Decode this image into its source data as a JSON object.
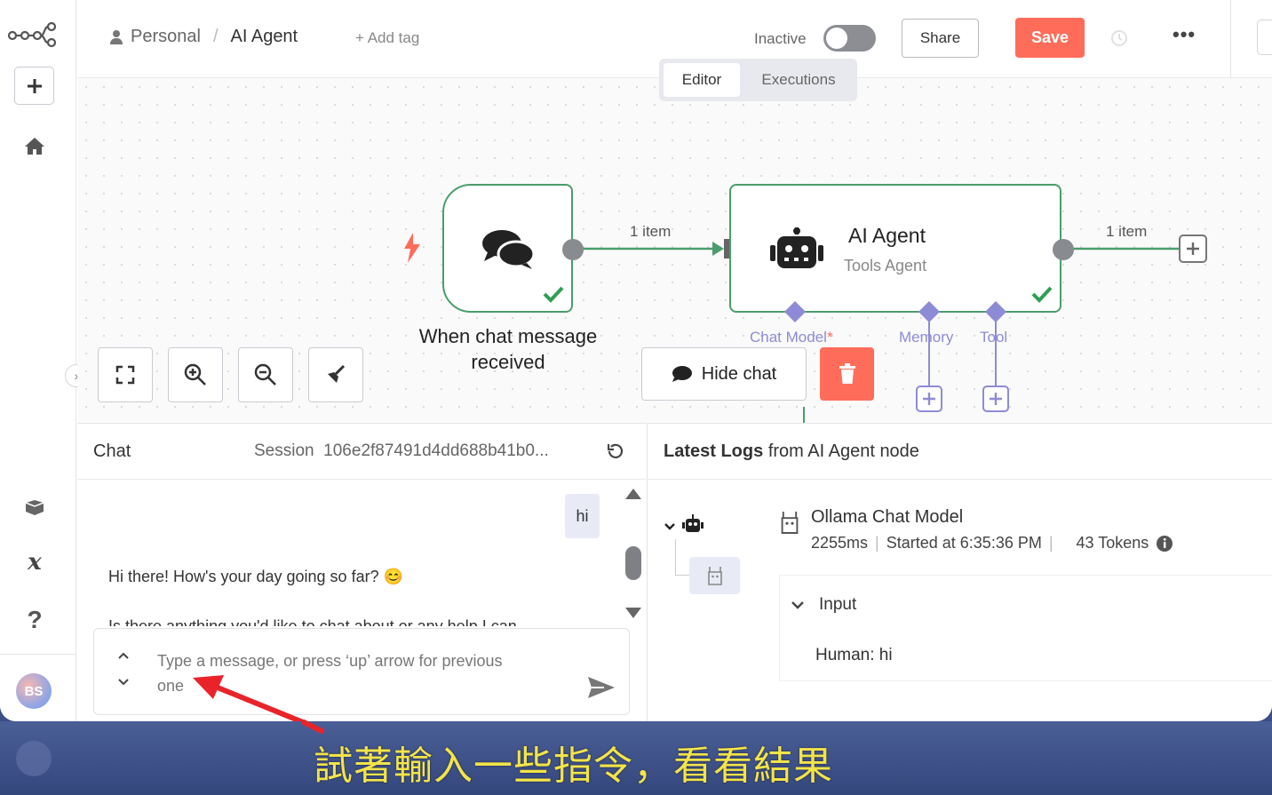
{
  "header": {
    "project_label": "Personal",
    "separator": "/",
    "workflow_name": "AI Agent",
    "add_tag": "+ Add tag",
    "status_label": "Inactive",
    "share_label": "Share",
    "save_label": "Save"
  },
  "tabs": [
    {
      "label": "Editor",
      "active": true
    },
    {
      "label": "Executions",
      "active": false
    }
  ],
  "nodes": {
    "trigger": {
      "label_line1": "When chat message",
      "label_line2": "received"
    },
    "agent": {
      "title": "AI Agent",
      "subtitle": "Tools Agent"
    },
    "connection_left": "1 item",
    "connection_right": "1 item",
    "ports": {
      "chat_model": "Chat Model",
      "required_mark": "*",
      "memory": "Memory",
      "tool": "Tool"
    }
  },
  "canvas_actions": {
    "hide_chat": "Hide chat"
  },
  "chat": {
    "title": "Chat",
    "session_label": "Session",
    "session_id": "106e2f87491d4dd688b41b0...",
    "user_message": "hi",
    "bot_message": "Hi there! How's your day going so far? 😊",
    "bot_message_cut": "Is there anything you'd like to chat about or any help I can",
    "input_placeholder_line1": "Type a message, or press ‘up’ arrow for previous",
    "input_placeholder_line2": "one"
  },
  "logs": {
    "title_bold": "Latest Logs",
    "title_rest": "from AI Agent node",
    "model_name": "Ollama Chat Model",
    "duration": "2255ms",
    "started": "Started at 6:35:36 PM",
    "tokens": "43 Tokens",
    "input_label": "Input",
    "input_value": "Human: hi"
  },
  "user": {
    "initials": "BS"
  },
  "caption": "試著輸入一些指令，看看結果",
  "colors": {
    "accent": "#ff6d5a",
    "node_border": "#4a9d6c",
    "port": "#8e8bd6",
    "caption_bg": "#3b4f86",
    "caption_text": "#f2e44a",
    "arrow": "#e8242a"
  }
}
